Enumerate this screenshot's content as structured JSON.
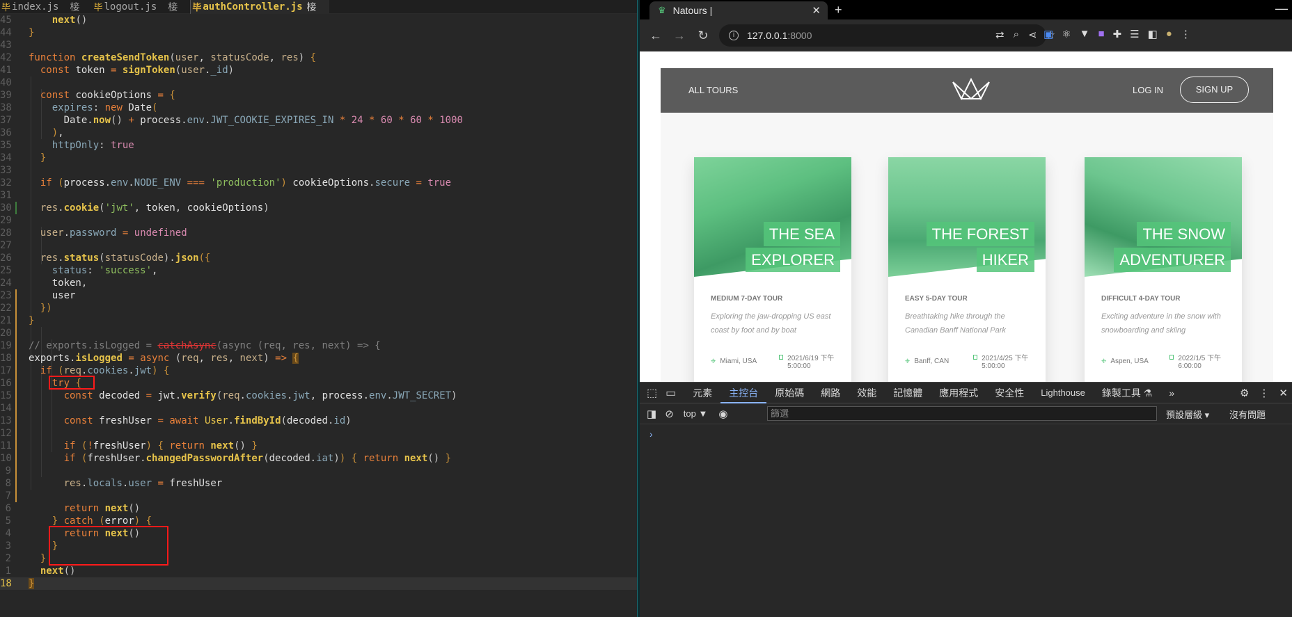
{
  "editor": {
    "tabs": [
      {
        "icon": "毕",
        "label": "index.js",
        "modified": "椄"
      },
      {
        "icon": "毕",
        "label": "logout.js",
        "modified": "椄"
      },
      {
        "icon": "毕",
        "label": "authController.js",
        "modified": "椄"
      }
    ],
    "line_numbers": [
      "45",
      "44",
      "43",
      "42",
      "41",
      "40",
      "39",
      "38",
      "37",
      "36",
      "35",
      "34",
      "33",
      "32",
      "31",
      "30",
      "29",
      "28",
      "27",
      "26",
      "25",
      "24",
      "23",
      "22",
      "21",
      "20",
      "19",
      "18",
      "17",
      "16",
      "15",
      "14",
      "13",
      "12",
      "11",
      "10",
      "9",
      "8",
      "7",
      "6",
      "5",
      "4",
      "3",
      "2",
      "1",
      "18"
    ]
  },
  "browser": {
    "tab_title": "Natours |",
    "url_host": "127.0.0.1",
    "url_port": ":8000",
    "site": {
      "nav_left": "ALL TOURS",
      "login": "LOG IN",
      "signup": "SIGN UP",
      "tours": [
        {
          "name_line1": "THE SEA",
          "name_line2": "EXPLORER",
          "subheading": "MEDIUM 7-DAY TOUR",
          "summary": "Exploring the jaw-dropping US east coast by foot and by boat",
          "location": "Miami, USA",
          "date": "2021/6/19 下午5:00:00"
        },
        {
          "name_line1": "THE FOREST",
          "name_line2": "HIKER",
          "subheading": "EASY 5-DAY TOUR",
          "summary": "Breathtaking hike through the Canadian Banff National Park",
          "location": "Banff, CAN",
          "date": "2021/4/25 下午5:00:00"
        },
        {
          "name_line1": "THE SNOW",
          "name_line2": "ADVENTURER",
          "subheading": "DIFFICULT 4-DAY TOUR",
          "summary": "Exciting adventure in the snow with snowboarding and skiing",
          "location": "Aspen, USA",
          "date": "2022/1/5 下午6:00:00"
        }
      ]
    },
    "devtools": {
      "tabs": [
        "元素",
        "主控台",
        "原始碼",
        "網路",
        "效能",
        "記憶體",
        "應用程式",
        "安全性",
        "Lighthouse",
        "錄製工具 ⚗"
      ],
      "context": "top ▼",
      "filter_placeholder": "篩選",
      "levels": "預設層級 ▾",
      "issues": "沒有問題",
      "prompt": "›"
    }
  },
  "colors": {
    "editor_bg": "#272727",
    "keyword": "#e8803a",
    "function": "#e6c34a",
    "string": "#8fbf5f",
    "number": "#d98ab0",
    "highlight_box": "#ff1a1a",
    "brand_green": "#55c57a"
  }
}
